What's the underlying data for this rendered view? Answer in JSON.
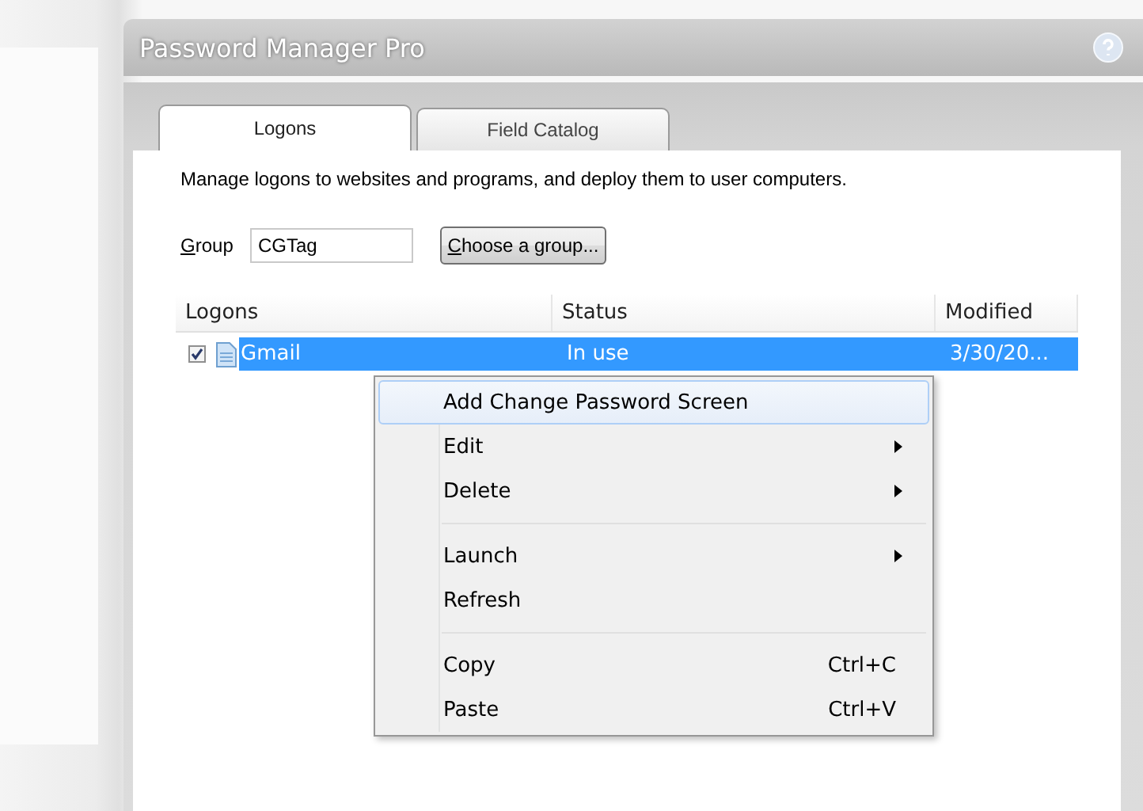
{
  "window": {
    "title": "Password Manager Pro"
  },
  "tabs": [
    {
      "label": "Logons",
      "selected": true
    },
    {
      "label": "Field Catalog",
      "selected": false
    }
  ],
  "description": "Manage logons to websites and programs, and deploy them to user computers.",
  "group": {
    "label": "Group",
    "value": "CGTag",
    "button": "Choose a group..."
  },
  "table": {
    "columns": [
      "Logons",
      "Status",
      "Modified"
    ],
    "rows": [
      {
        "checked": true,
        "selected": true,
        "cells": [
          "Gmail",
          "In use",
          "3/30/20..."
        ]
      }
    ]
  },
  "context_menu": {
    "items": [
      {
        "kind": "item",
        "label": "Add Change Password Screen",
        "selected": true,
        "submenu": false
      },
      {
        "kind": "item",
        "label": "Edit",
        "selected": false,
        "submenu": true
      },
      {
        "kind": "item",
        "label": "Delete",
        "selected": false,
        "submenu": true
      },
      {
        "kind": "separator"
      },
      {
        "kind": "item",
        "label": "Launch",
        "selected": false,
        "submenu": true
      },
      {
        "kind": "item",
        "label": "Refresh",
        "selected": false,
        "submenu": false
      },
      {
        "kind": "separator"
      },
      {
        "kind": "item",
        "label": "Copy",
        "selected": false,
        "submenu": false,
        "shortcut": "Ctrl+C"
      },
      {
        "kind": "item",
        "label": "Paste",
        "selected": false,
        "submenu": false,
        "shortcut": "Ctrl+V"
      }
    ]
  }
}
